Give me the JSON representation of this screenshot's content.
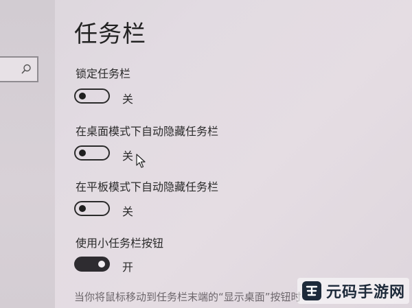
{
  "header": {
    "title": "任务栏"
  },
  "search": {
    "icon": "search-icon"
  },
  "settings": [
    {
      "label": "锁定任务栏",
      "state": "关",
      "on": false
    },
    {
      "label": "在桌面模式下自动隐藏任务栏",
      "state": "关",
      "on": false
    },
    {
      "label": "在平板模式下自动隐藏任务栏",
      "state": "关",
      "on": false
    },
    {
      "label": "使用小任务栏按钮",
      "state": "开",
      "on": true
    }
  ],
  "footer": {
    "text": "当你将鼠标移动到任务栏末端的“显示桌面”按钮时"
  },
  "watermark": {
    "text": "元码手游网"
  }
}
